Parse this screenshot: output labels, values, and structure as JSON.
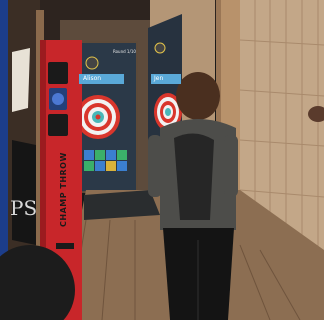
{
  "scene": {
    "player_name": "Alison",
    "player_name_2": "Jen",
    "round_label": "Round 1/10",
    "sign_text": "PS",
    "brand_text": "CHAMP THROW"
  },
  "colors": {
    "target_red": "#d9362c",
    "target_white": "#f2f2f2",
    "target_teal": "#49b7b8",
    "machine_red": "#c8262a",
    "wood": "#a88a6a",
    "screen_bg": "#2b3948"
  }
}
